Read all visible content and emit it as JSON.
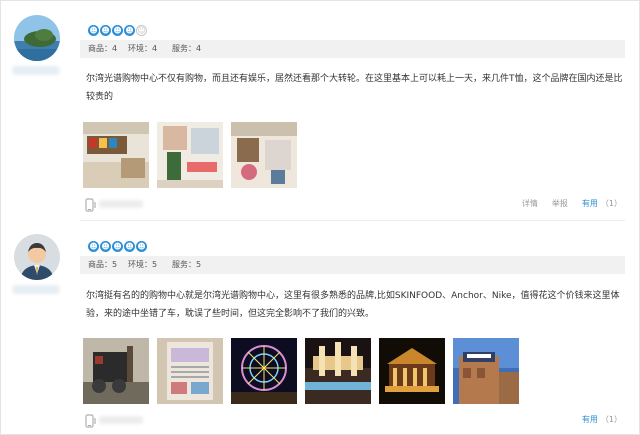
{
  "reviews": [
    {
      "stars": [
        "☻",
        "☻",
        "☻",
        "☻",
        "☺"
      ],
      "scores": [
        "商品：4",
        "环境：4",
        "服务：4"
      ],
      "text": "尔湾光谱购物中心不仅有购物，而且还有娱乐，居然还看那个大转轮。在这里基本上可以耗上一天，来几件T恤，这个品牌在国内还是比较贵的",
      "actions": {
        "detail": "详情",
        "report": "举报",
        "useful": "有用",
        "useful_count": "（1）"
      }
    },
    {
      "stars": [
        "☻",
        "☻",
        "☻",
        "☻",
        "☻"
      ],
      "scores": [
        "商品：5",
        "环境：5",
        "服务：5"
      ],
      "text": "尔湾挺有名的的购物中心就是尔湾光谱购物中心，这里有很多熟悉的品牌,比如SKINFOOD、Anchor、Nike，值得花这个价钱来这里体验，来的途中坐错了车，耽误了些时间，但这完全影响不了我们的兴致。",
      "actions": {
        "useful": "有用",
        "useful_count": "（1）"
      }
    }
  ],
  "icons": {
    "phone": "phone-icon",
    "star": "star-icon"
  },
  "colors": {
    "accent": "#2d8fd8",
    "score_bar": "#f1f1f1",
    "text": "#333333",
    "muted": "#999999"
  }
}
